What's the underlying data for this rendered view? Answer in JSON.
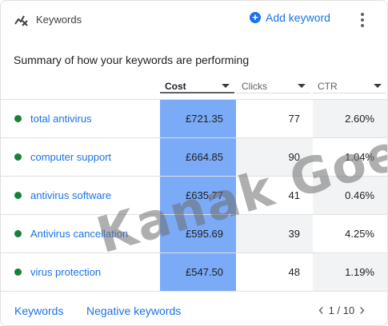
{
  "header": {
    "title": "Keywords",
    "add_keyword_label": "Add keyword",
    "icons": {
      "keywords": "keyword-trend-icon",
      "add": "add-circle-icon",
      "menu": "more-vert-icon"
    }
  },
  "summary_title": "Summary of how your keywords are performing",
  "columns": [
    {
      "label": "Cost",
      "active": true
    },
    {
      "label": "Clicks",
      "active": false
    },
    {
      "label": "CTR",
      "active": false
    }
  ],
  "rows": [
    {
      "keyword": "total antivirus",
      "cost": "£721.35",
      "clicks": "77",
      "ctr": "2.60%"
    },
    {
      "keyword": "computer support",
      "cost": "£664.85",
      "clicks": "90",
      "ctr": "1.04%"
    },
    {
      "keyword": "antivirus software",
      "cost": "£635.77",
      "clicks": "41",
      "ctr": "0.46%"
    },
    {
      "keyword": "Antivirus cancellation",
      "cost": "£595.69",
      "clicks": "39",
      "ctr": "4.25%"
    },
    {
      "keyword": "virus protection",
      "cost": "£547.50",
      "clicks": "48",
      "ctr": "1.19%"
    }
  ],
  "footer": {
    "keywords_link": "Keywords",
    "negative_keywords_link": "Negative keywords",
    "pagination": "1 / 10",
    "prev_icon": "‹",
    "next_icon": "›"
  },
  "watermark": "Kanak Goel",
  "colors": {
    "accent": "#1a73e8",
    "status_dot": "#188038",
    "highlight_cost": "#7baaf7",
    "cell_shade": "#f1f3f4"
  }
}
